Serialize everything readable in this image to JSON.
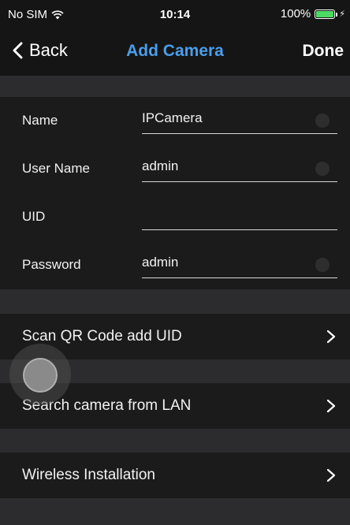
{
  "status_bar": {
    "carrier": "No SIM",
    "time": "10:14",
    "battery": "100%",
    "battery_color": "#4cd964",
    "icons": [
      "wifi-icon",
      "battery-icon",
      "charging-bolt-icon"
    ]
  },
  "nav": {
    "back_label": "Back",
    "title": "Add Camera",
    "done_label": "Done",
    "title_color": "#4a9eec"
  },
  "form": {
    "name": {
      "label": "Name",
      "value": "IPCamera"
    },
    "username": {
      "label": "User Name",
      "value": "admin"
    },
    "uid": {
      "label": "UID",
      "value": ""
    },
    "password": {
      "label": "Password",
      "value": "admin"
    }
  },
  "actions": {
    "scan_qr": "Scan QR Code add UID",
    "search_lan": "Search camera from LAN",
    "wireless": "Wireless Installation"
  }
}
